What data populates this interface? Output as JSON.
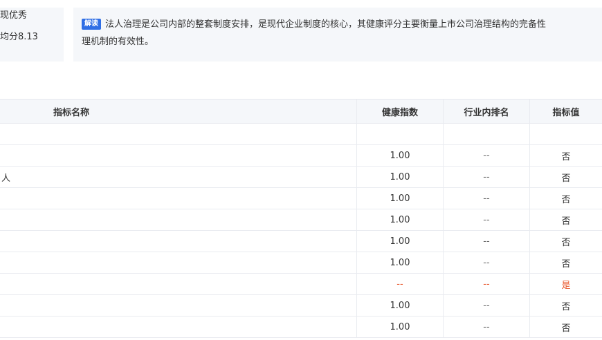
{
  "summary": {
    "line1": "现优秀",
    "line2": "均分8.13"
  },
  "note": {
    "badge": "解读",
    "text_line1": "法人治理是公司内部的整套制度安排，是现代企业制度的核心，其健康评分主要衡量上市公司治理结构的完备性",
    "text_line2": "理机制的有效性。"
  },
  "table": {
    "headers": {
      "name": "指标名称",
      "health": "健康指数",
      "rank": "行业内排名",
      "value": "指标值"
    },
    "rows": [
      {
        "name": "",
        "health": "",
        "rank": "",
        "value": "",
        "flag": false
      },
      {
        "name": "",
        "health": "1.00",
        "rank": "--",
        "value": "否",
        "flag": false
      },
      {
        "name": "人",
        "health": "1.00",
        "rank": "--",
        "value": "否",
        "flag": false
      },
      {
        "name": "",
        "health": "1.00",
        "rank": "--",
        "value": "否",
        "flag": false
      },
      {
        "name": "",
        "health": "1.00",
        "rank": "--",
        "value": "否",
        "flag": false
      },
      {
        "name": "",
        "health": "1.00",
        "rank": "--",
        "value": "否",
        "flag": false
      },
      {
        "name": "",
        "health": "1.00",
        "rank": "--",
        "value": "否",
        "flag": false
      },
      {
        "name": "",
        "health": "--",
        "rank": "--",
        "value": "是",
        "flag": true
      },
      {
        "name": "",
        "health": "1.00",
        "rank": "--",
        "value": "否",
        "flag": false
      },
      {
        "name": "",
        "health": "1.00",
        "rank": "--",
        "value": "否",
        "flag": false
      }
    ]
  },
  "colors": {
    "badge_bg": "#2f6ee5",
    "alert": "#e8562a",
    "panel_bg": "#f5f7fa"
  }
}
